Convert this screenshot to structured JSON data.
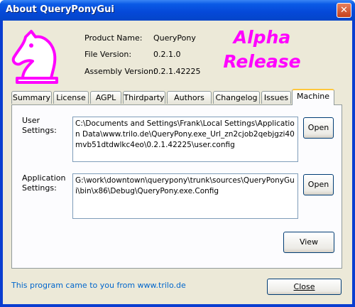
{
  "window": {
    "title": "About QueryPonyGui",
    "close_glyph": "✕"
  },
  "product": {
    "rows": [
      {
        "label": "Product Name:",
        "value": "QueryPony"
      },
      {
        "label": "File Version:",
        "value": "0.2.1.0"
      },
      {
        "label": "Assembly Version:",
        "value": "0.2.1.42225"
      }
    ]
  },
  "badge": {
    "line1": "Alpha",
    "line2": "Release",
    "color": "#ff00ff"
  },
  "tabs": [
    {
      "label": "Summary"
    },
    {
      "label": "License"
    },
    {
      "label": "AGPL"
    },
    {
      "label": "Thirdparty"
    },
    {
      "label": "Authors"
    },
    {
      "label": "Changelog"
    },
    {
      "label": "Issues"
    },
    {
      "label": "Machine",
      "active": true
    }
  ],
  "machine": {
    "user_settings": {
      "label_line1": "User",
      "label_line2": "Settings:",
      "path": "C:\\Documents and Settings\\Frank\\Local Settings\\Application Data\\www.trilo.de\\QueryPony.exe_Url_zn2cjob2qebjgzi40mvb51dtdwlkc4eo\\0.2.1.42225\\user.config",
      "open_label": "Open"
    },
    "app_settings": {
      "label_line1": "Application",
      "label_line2": "Settings:",
      "path": "G:\\work\\downtown\\querypony\\trunk\\sources\\QueryPonyGui\\bin\\x86\\Debug\\QueryPony.exe.Config",
      "open_label": "Open"
    },
    "view_label": "View"
  },
  "footer": {
    "link_text": "This program came to you from www.trilo.de",
    "close_label": "Close"
  },
  "icons": {
    "logo": "knight-chess-piece-icon",
    "logo_color": "#ff00ff"
  }
}
